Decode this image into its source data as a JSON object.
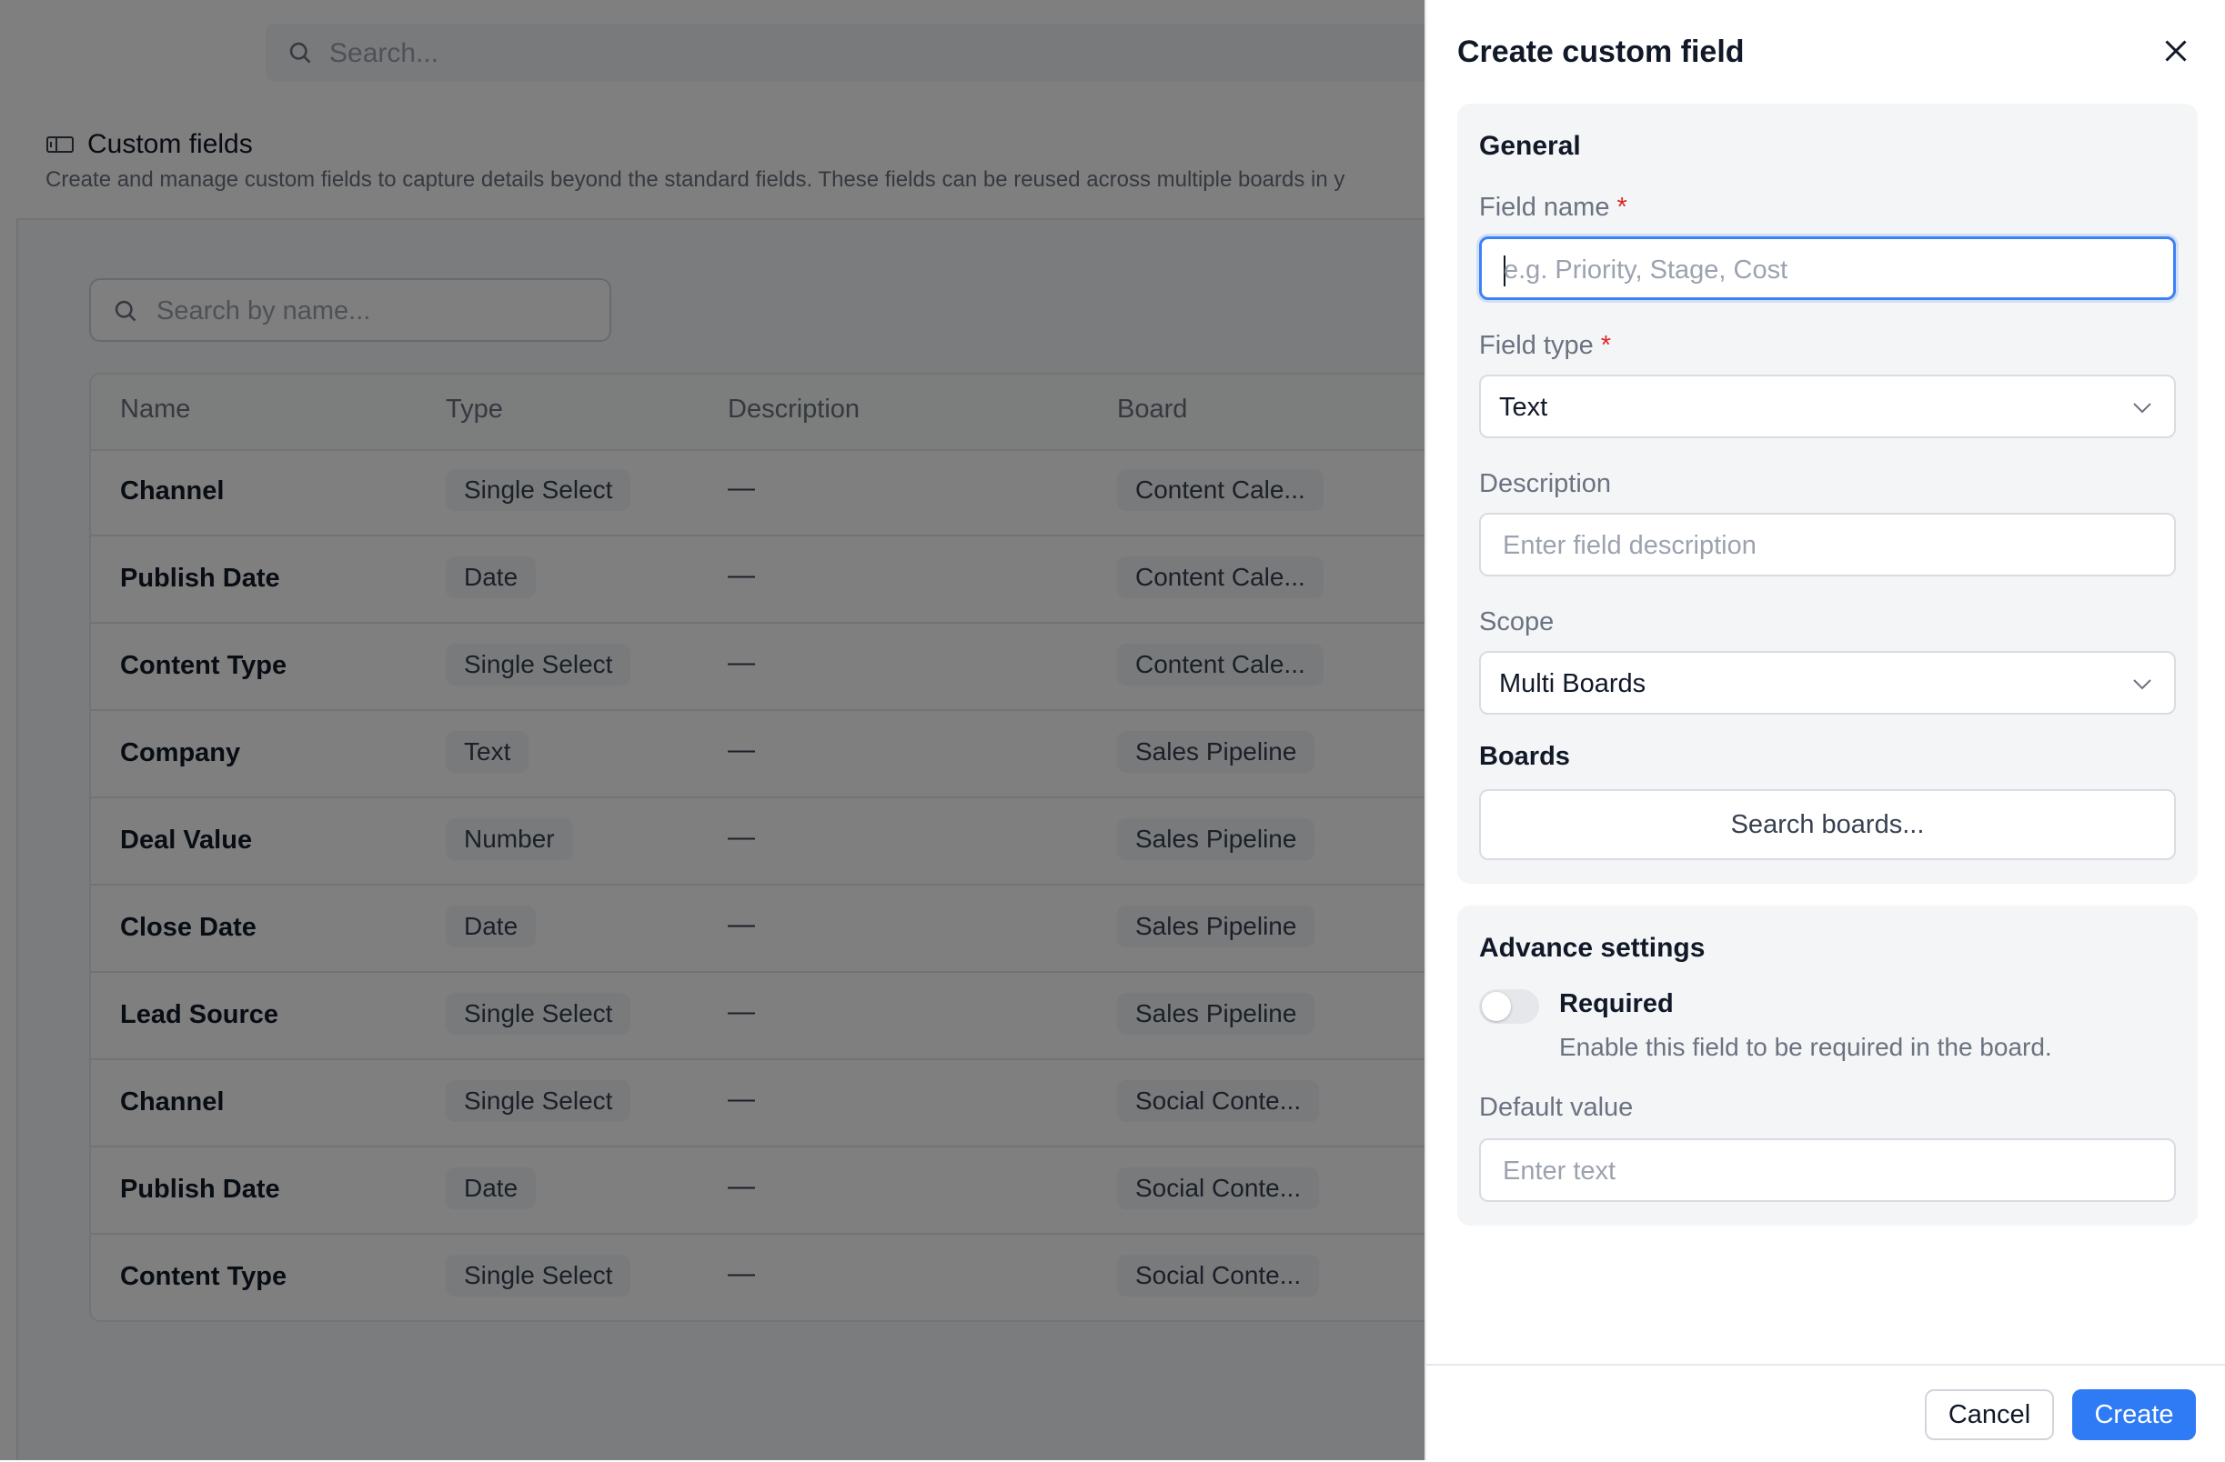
{
  "app": {
    "top_search_placeholder": "Search...",
    "page_title": "Custom fields",
    "page_description": "Create and manage custom fields to capture details beyond the standard fields. These fields can be reused across multiple boards in y",
    "list_search_placeholder": "Search by name...",
    "table": {
      "columns": [
        "Name",
        "Type",
        "Description",
        "Board"
      ],
      "rows": [
        {
          "name": "Channel",
          "type": "Single Select",
          "description": "—",
          "board": "Content Cale..."
        },
        {
          "name": "Publish Date",
          "type": "Date",
          "description": "—",
          "board": "Content Cale..."
        },
        {
          "name": "Content Type",
          "type": "Single Select",
          "description": "—",
          "board": "Content Cale..."
        },
        {
          "name": "Company",
          "type": "Text",
          "description": "—",
          "board": "Sales Pipeline"
        },
        {
          "name": "Deal Value",
          "type": "Number",
          "description": "—",
          "board": "Sales Pipeline"
        },
        {
          "name": "Close Date",
          "type": "Date",
          "description": "—",
          "board": "Sales Pipeline"
        },
        {
          "name": "Lead Source",
          "type": "Single Select",
          "description": "—",
          "board": "Sales Pipeline"
        },
        {
          "name": "Channel",
          "type": "Single Select",
          "description": "—",
          "board": "Social Conte..."
        },
        {
          "name": "Publish Date",
          "type": "Date",
          "description": "—",
          "board": "Social Conte..."
        },
        {
          "name": "Content Type",
          "type": "Single Select",
          "description": "—",
          "board": "Social Conte..."
        }
      ]
    }
  },
  "drawer": {
    "title": "Create custom field",
    "general": {
      "title": "General",
      "field_name_label": "Field name",
      "required_mark": "*",
      "field_name_placeholder": "e.g. Priority, Stage, Cost",
      "field_type_label": "Field type",
      "field_type_value": "Text",
      "description_label": "Description",
      "description_placeholder": "Enter field description",
      "scope_label": "Scope",
      "scope_value": "Multi Boards",
      "boards_label": "Boards",
      "boards_button": "Search boards..."
    },
    "advanced": {
      "title": "Advance settings",
      "required_label": "Required",
      "required_description": "Enable this field to be required in the board.",
      "required_on": false,
      "default_value_label": "Default value",
      "default_value_placeholder": "Enter text"
    },
    "footer": {
      "cancel": "Cancel",
      "create": "Create"
    }
  },
  "colors": {
    "primary": "#2f7bf5",
    "focus_ring": "#3b82f6",
    "required": "#dc2626",
    "overlay": "rgba(0,0,0,0.5)"
  }
}
